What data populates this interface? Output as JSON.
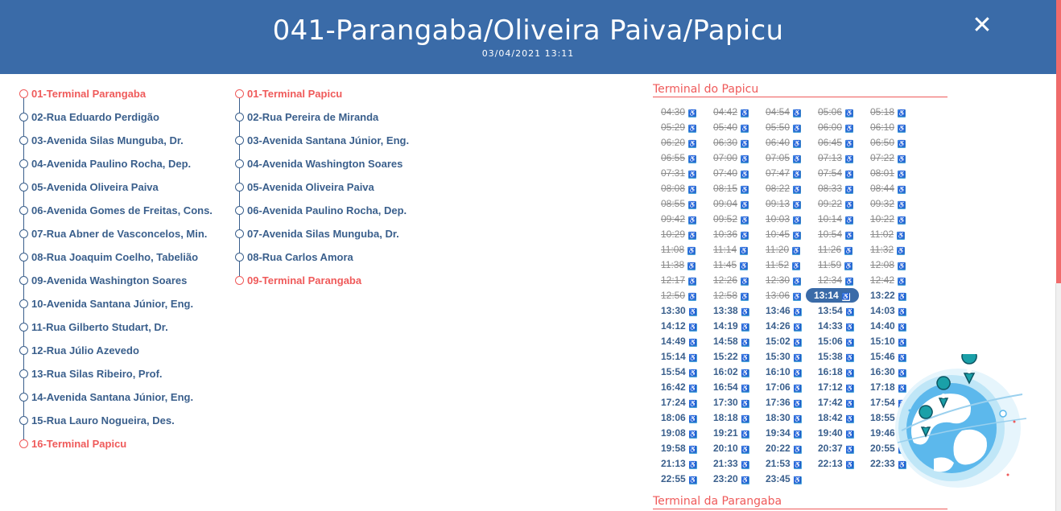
{
  "header": {
    "title": "041-Parangaba/Oliveira Paiva/Papicu",
    "datetime": "03/04/2021 13:11",
    "close_icon": "close-icon",
    "background": "#3a6ba8"
  },
  "route_outbound": {
    "stops": [
      {
        "label": "01-Terminal Parangaba",
        "terminal": true
      },
      {
        "label": "02-Rua Eduardo Perdigão",
        "terminal": false
      },
      {
        "label": "03-Avenida Silas Munguba, Dr.",
        "terminal": false
      },
      {
        "label": "04-Avenida Paulino Rocha, Dep.",
        "terminal": false
      },
      {
        "label": "05-Avenida Oliveira Paiva",
        "terminal": false
      },
      {
        "label": "06-Avenida Gomes de Freitas, Cons.",
        "terminal": false
      },
      {
        "label": "07-Rua Abner de Vasconcelos, Min.",
        "terminal": false
      },
      {
        "label": "08-Rua Joaquim Coelho, Tabelião",
        "terminal": false
      },
      {
        "label": "09-Avenida Washington Soares",
        "terminal": false
      },
      {
        "label": "10-Avenida Santana Júnior, Eng.",
        "terminal": false
      },
      {
        "label": "11-Rua Gilberto Studart, Dr.",
        "terminal": false
      },
      {
        "label": "12-Rua Júlio Azevedo",
        "terminal": false
      },
      {
        "label": "13-Rua Silas Ribeiro, Prof.",
        "terminal": false
      },
      {
        "label": "14-Avenida Santana Júnior, Eng.",
        "terminal": false
      },
      {
        "label": "15-Rua Lauro Nogueira, Des.",
        "terminal": false
      },
      {
        "label": "16-Terminal Papicu",
        "terminal": true
      }
    ]
  },
  "route_return": {
    "stops": [
      {
        "label": "01-Terminal Papicu",
        "terminal": true
      },
      {
        "label": "02-Rua Pereira de Miranda",
        "terminal": false
      },
      {
        "label": "03-Avenida Santana Júnior, Eng.",
        "terminal": false
      },
      {
        "label": "04-Avenida Washington Soares",
        "terminal": false
      },
      {
        "label": "05-Avenida Oliveira Paiva",
        "terminal": false
      },
      {
        "label": "06-Avenida Paulino Rocha, Dep.",
        "terminal": false
      },
      {
        "label": "07-Avenida Silas Munguba, Dr.",
        "terminal": false
      },
      {
        "label": "08-Rua Carlos Amora",
        "terminal": false
      },
      {
        "label": "09-Terminal Parangaba",
        "terminal": true
      }
    ]
  },
  "schedule": {
    "section_papicu": "Terminal do Papicu",
    "section_parangaba": "Terminal da Parangaba",
    "accessibility_icon": "wheelchair-icon",
    "current_time": "13:14",
    "departures": [
      "04:30",
      "04:42",
      "04:54",
      "05:06",
      "05:18",
      "05:29",
      "05:40",
      "05:50",
      "06:00",
      "06:10",
      "06:20",
      "06:30",
      "06:40",
      "06:45",
      "06:50",
      "06:55",
      "07:00",
      "07:05",
      "07:13",
      "07:22",
      "07:31",
      "07:40",
      "07:47",
      "07:54",
      "08:01",
      "08:08",
      "08:15",
      "08:22",
      "08:33",
      "08:44",
      "08:55",
      "09:04",
      "09:13",
      "09:22",
      "09:32",
      "09:42",
      "09:52",
      "10:03",
      "10:14",
      "10:22",
      "10:29",
      "10:36",
      "10:45",
      "10:54",
      "11:02",
      "11:08",
      "11:14",
      "11:20",
      "11:26",
      "11:32",
      "11:38",
      "11:45",
      "11:52",
      "11:59",
      "12:08",
      "12:17",
      "12:26",
      "12:30",
      "12:34",
      "12:42",
      "12:50",
      "12:58",
      "13:06",
      "13:14",
      "13:22",
      "13:30",
      "13:38",
      "13:46",
      "13:54",
      "14:03",
      "14:12",
      "14:19",
      "14:26",
      "14:33",
      "14:40",
      "14:49",
      "14:58",
      "15:02",
      "15:06",
      "15:10",
      "15:14",
      "15:22",
      "15:30",
      "15:38",
      "15:46",
      "15:54",
      "16:02",
      "16:10",
      "16:18",
      "16:30",
      "16:42",
      "16:54",
      "17:06",
      "17:12",
      "17:18",
      "17:24",
      "17:30",
      "17:36",
      "17:42",
      "17:54",
      "18:06",
      "18:18",
      "18:30",
      "18:42",
      "18:55",
      "19:08",
      "19:21",
      "19:34",
      "19:40",
      "19:46",
      "19:58",
      "20:10",
      "20:22",
      "20:37",
      "20:55",
      "21:13",
      "21:33",
      "21:53",
      "22:13",
      "22:33",
      "22:55",
      "23:20",
      "23:45"
    ],
    "past_count": 63
  },
  "colors": {
    "accent": "#3a6ba8",
    "terminal": "#ef5a5a",
    "stop_text": "#3a5f8c",
    "past_text": "#8c8c8c",
    "accessibility": "#4aa3df"
  }
}
